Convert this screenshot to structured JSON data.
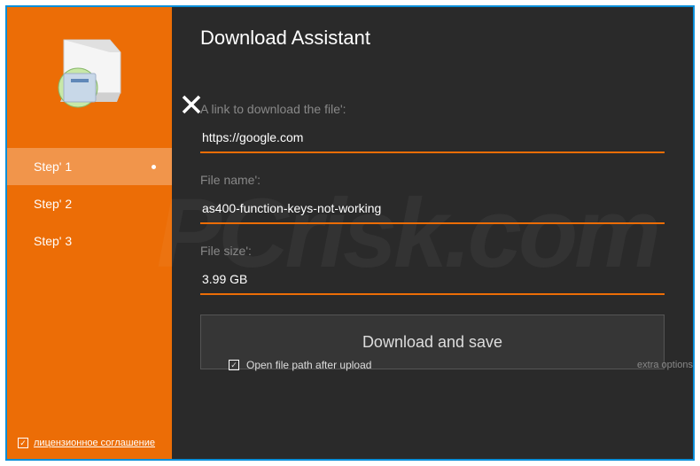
{
  "title": "Download Assistant",
  "sidebar": {
    "steps": [
      {
        "label": "Step' 1"
      },
      {
        "label": "Step' 2"
      },
      {
        "label": "Step' 3"
      }
    ],
    "license_label": "лицензионное соглашение"
  },
  "fields": {
    "link": {
      "label": "A link to download the file':",
      "value": "https://google.com"
    },
    "filename": {
      "label": "File name':",
      "value": "as400-function-keys-not-working"
    },
    "filesize": {
      "label": "File size':",
      "value": "3.99 GB"
    }
  },
  "download_button": "Download and save",
  "open_path_label": "Open file path after upload",
  "extra_options": "extra options",
  "watermark": "PCrisk.com",
  "checkmark": "✓"
}
